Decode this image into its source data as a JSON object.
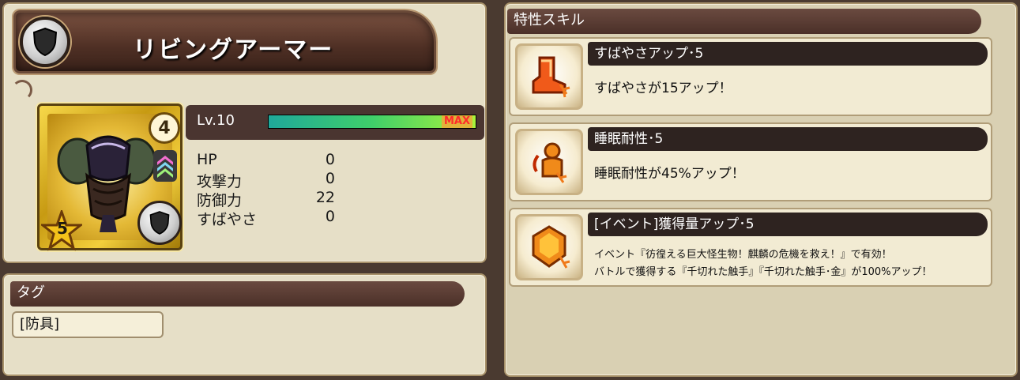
{
  "character": {
    "name": "リビングアーマー",
    "rank": "4",
    "stars": "5",
    "level_label": "Lv.10",
    "exp_fraction": 1.0,
    "exp_max_label": "MAX"
  },
  "stats": [
    {
      "name": "HP",
      "value": "0"
    },
    {
      "name": "攻撃力",
      "value": "0"
    },
    {
      "name": "防御力",
      "value": "22"
    },
    {
      "name": "すばやさ",
      "value": "0"
    }
  ],
  "tags": {
    "header": "タグ",
    "items": [
      "[防具]"
    ]
  },
  "skills": {
    "header": "特性スキル",
    "items": [
      {
        "icon": "boot-icon",
        "name": "すばやさアップ･5",
        "desc": "すばやさが15アップ！"
      },
      {
        "icon": "sleep-resist-icon",
        "name": "睡眠耐性･5",
        "desc": "睡眠耐性が45%アップ！"
      },
      {
        "icon": "gem-icon",
        "name": "[イベント]獲得量アップ･5",
        "desc_line1": "イベント『彷徨える巨大怪生物！麒麟の危機を救え！』で有効！",
        "desc_line2": "バトルで獲得する『千切れた触手』『千切れた触手･金』が100%アップ！"
      }
    ]
  },
  "colors": {
    "panel_bg": "#e6dfc7",
    "header_bg": "#4b3028",
    "exp_bar": "#3fcf6a",
    "max_label": "#ff2b2b"
  }
}
